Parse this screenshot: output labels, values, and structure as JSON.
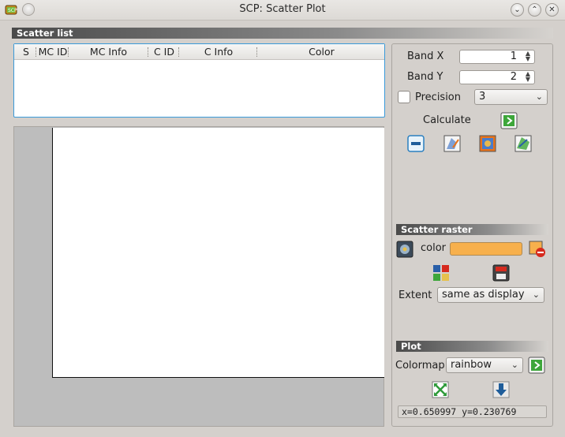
{
  "window": {
    "title": "SCP: Scatter Plot"
  },
  "scatter_list": {
    "header": "Scatter list",
    "columns": [
      "S",
      "MC ID",
      "MC Info",
      "C ID",
      "C Info",
      "Color"
    ],
    "rows": []
  },
  "settings": {
    "band_x_label": "Band X",
    "band_x_value": "1",
    "band_y_label": "Band Y",
    "band_y_value": "2",
    "precision_label": "Precision",
    "precision_checked": false,
    "precision_value": "3",
    "calculate_label": "Calculate"
  },
  "scatter_raster": {
    "header": "Scatter raster",
    "color_label": "color",
    "color_value": "#f7b04c",
    "extent_label": "Extent",
    "extent_value": "same as display"
  },
  "plot": {
    "header": "Plot",
    "colormap_label": "Colormap",
    "colormap_value": "rainbow",
    "coordinates": "x=0.650997 y=0.230769"
  }
}
